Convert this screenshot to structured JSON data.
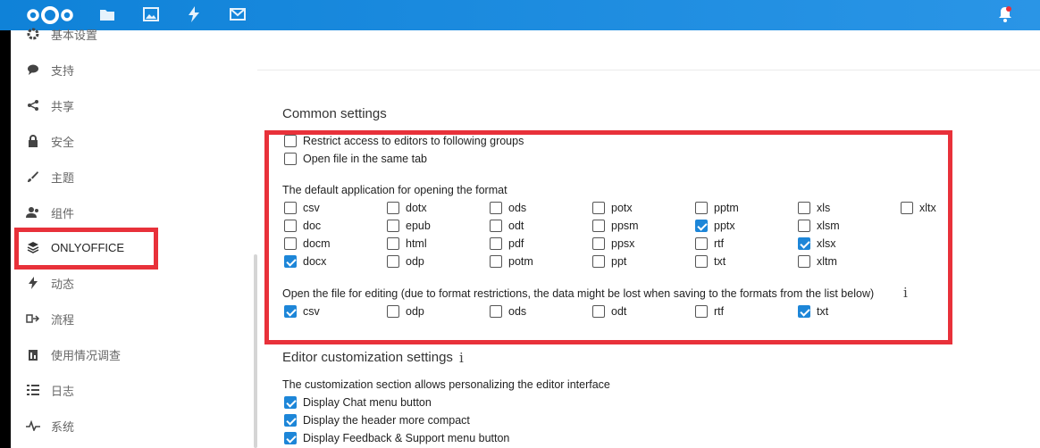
{
  "topbar": {
    "apps": [
      "files-icon",
      "photos-icon",
      "activity-icon",
      "mail-icon"
    ],
    "accent": "#1d8ce0"
  },
  "sidebar": {
    "items": [
      {
        "label": "基本设置",
        "icon": "gear-icon"
      },
      {
        "label": "支持",
        "icon": "chat-bubble-icon"
      },
      {
        "label": "共享",
        "icon": "share-icon"
      },
      {
        "label": "安全",
        "icon": "lock-icon"
      },
      {
        "label": "主题",
        "icon": "brush-icon"
      },
      {
        "label": "组件",
        "icon": "users-icon"
      },
      {
        "label": "ONLYOFFICE",
        "icon": "layers-icon"
      },
      {
        "label": "动态",
        "icon": "bolt-icon"
      },
      {
        "label": "流程",
        "icon": "flow-icon"
      },
      {
        "label": "使用情况调查",
        "icon": "survey-icon"
      },
      {
        "label": "日志",
        "icon": "list-icon"
      },
      {
        "label": "系统",
        "icon": "pulse-icon"
      }
    ],
    "active_index": 6
  },
  "common": {
    "title": "Common settings",
    "restrict_label": "Restrict access to editors to following groups",
    "same_tab_label": "Open file in the same tab",
    "default_app_title": "The default application for opening the format",
    "formats": [
      {
        "label": "csv",
        "checked": false
      },
      {
        "label": "dotx",
        "checked": false
      },
      {
        "label": "ods",
        "checked": false
      },
      {
        "label": "potx",
        "checked": false
      },
      {
        "label": "pptm",
        "checked": false
      },
      {
        "label": "xls",
        "checked": false
      },
      {
        "label": "xltx",
        "checked": false
      },
      {
        "label": "doc",
        "checked": false
      },
      {
        "label": "epub",
        "checked": false
      },
      {
        "label": "odt",
        "checked": false
      },
      {
        "label": "ppsm",
        "checked": false
      },
      {
        "label": "pptx",
        "checked": true
      },
      {
        "label": "xlsm",
        "checked": false
      },
      {
        "label": "docm",
        "checked": false
      },
      {
        "label": "html",
        "checked": false
      },
      {
        "label": "pdf",
        "checked": false
      },
      {
        "label": "ppsx",
        "checked": false
      },
      {
        "label": "rtf",
        "checked": false
      },
      {
        "label": "xlsx",
        "checked": true
      },
      {
        "label": "docx",
        "checked": true
      },
      {
        "label": "odp",
        "checked": false
      },
      {
        "label": "potm",
        "checked": false
      },
      {
        "label": "ppt",
        "checked": false
      },
      {
        "label": "txt",
        "checked": false
      },
      {
        "label": "xltm",
        "checked": false
      }
    ],
    "edit_title": "Open the file for editing (due to format restrictions, the data might be lost when saving to the formats from the list below)",
    "edit_formats": [
      {
        "label": "csv",
        "checked": true
      },
      {
        "label": "odp",
        "checked": false
      },
      {
        "label": "ods",
        "checked": false
      },
      {
        "label": "odt",
        "checked": false
      },
      {
        "label": "rtf",
        "checked": false
      },
      {
        "label": "txt",
        "checked": true
      }
    ]
  },
  "customization": {
    "title": "Editor customization settings",
    "desc": "The customization section allows personalizing the editor interface",
    "options": [
      {
        "label": "Display Chat menu button",
        "checked": true
      },
      {
        "label": "Display the header more compact",
        "checked": true
      },
      {
        "label": "Display Feedback & Support menu button",
        "checked": true
      }
    ]
  }
}
